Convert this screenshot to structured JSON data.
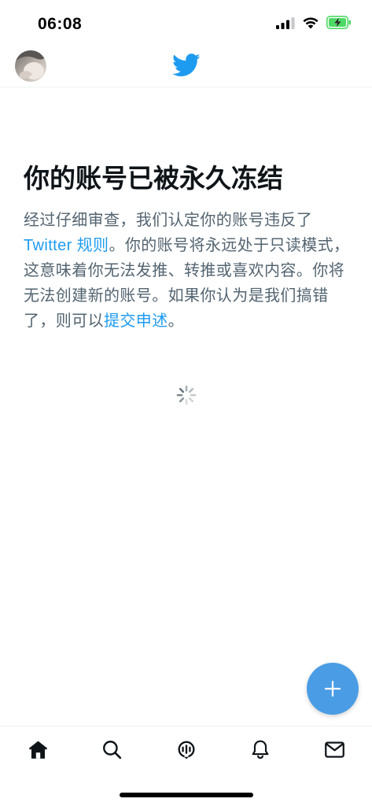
{
  "status_bar": {
    "time": "06:08",
    "icons": [
      "signal-icon",
      "wifi-icon",
      "battery-charging-icon"
    ],
    "battery_color": "#4cd964"
  },
  "header": {
    "avatar_icon": "avatar",
    "logo_icon": "twitter-bird-icon",
    "brand_color": "#1d9bf0"
  },
  "main": {
    "title": "你的账号已被永久冻结",
    "body_part1": "经过仔细审查，我们认定你的账号违反了",
    "rules_link": "Twitter 规则",
    "body_part2": "。你的账号将永远处于只读模式，这意味着你无法发推、转推或喜欢内容。你将无法创建新的账号。如果你认为是我们搞错了，则可以",
    "appeal_link": "提交申述",
    "body_part3": "。",
    "loading_icon": "loading-spinner-icon"
  },
  "fab": {
    "icon": "plus-icon",
    "color": "#4a9de5"
  },
  "tab_bar": {
    "tabs": [
      "home-icon",
      "search-icon",
      "spaces-icon",
      "notifications-icon",
      "messages-icon"
    ]
  }
}
